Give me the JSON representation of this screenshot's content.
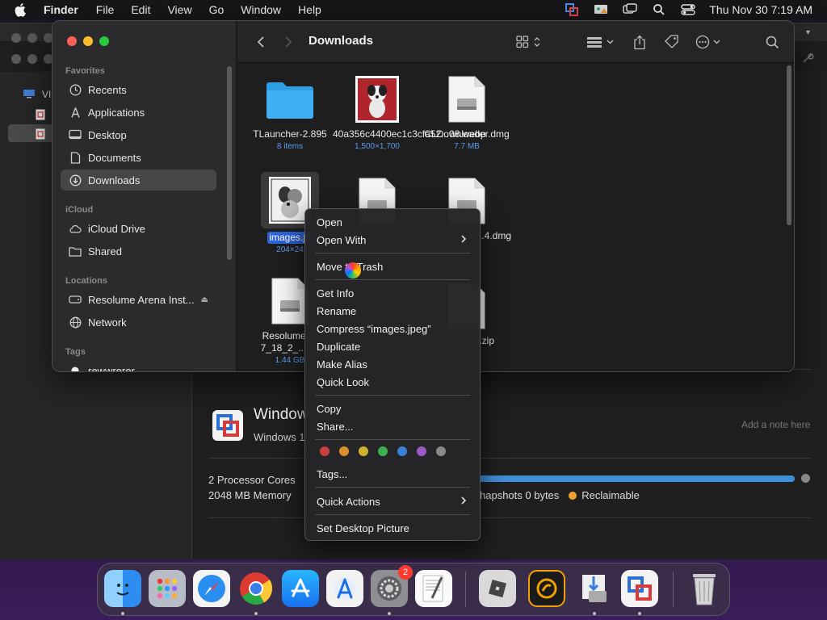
{
  "menubar": {
    "app_name": "Finder",
    "items": [
      "File",
      "Edit",
      "View",
      "Go",
      "Window",
      "Help"
    ],
    "clock": "Thu Nov 30  7:19 AM"
  },
  "vm_window": {
    "title": "Window",
    "subtitle": "Windows 1",
    "note_placeholder": "Add a note here",
    "cpu": "2 Processor Cores",
    "memory": "2048 MB Memory",
    "snapshots": "hapshots  0 bytes",
    "reclaimable": "Reclaimable",
    "sidebar_label": "VI"
  },
  "finder": {
    "title": "Downloads",
    "sidebar": {
      "favorites_header": "Favorites",
      "favorites": [
        "Recents",
        "Applications",
        "Desktop",
        "Documents",
        "Downloads"
      ],
      "icloud_header": "iCloud",
      "icloud": [
        "iCloud Drive",
        "Shared"
      ],
      "locations_header": "Locations",
      "locations": [
        "Resolume Arena Inst...",
        "Network"
      ],
      "tags_header": "Tags",
      "tags": [
        "rewwrerer"
      ]
    },
    "files": [
      {
        "name": "TLauncher-2.895",
        "meta": "8 items",
        "kind": "folder"
      },
      {
        "name": "40a356c4400ec1c3cfa52...08.webp",
        "meta": "1,500×1,700",
        "kind": "image"
      },
      {
        "name": "CLDownloader.dmg",
        "meta": "7.7 MB",
        "kind": "dmg"
      },
      {
        "name": "images.jp",
        "meta": "204×24",
        "kind": "image"
      },
      {
        "name": "",
        "meta": "",
        "kind": "dmg"
      },
      {
        "name": "v1-...4.dmg",
        "meta": "",
        "kind": "dmg"
      },
      {
        "name": "Resolume_A 7_18_2_...ller",
        "meta": "1.44 GB",
        "kind": "dmg"
      },
      {
        "name": "in.zip",
        "meta": "",
        "kind": "zip"
      }
    ]
  },
  "context_menu": {
    "items": {
      "open": "Open",
      "open_with": "Open With",
      "move_to_trash": "Move to Trash",
      "get_info": "Get Info",
      "rename": "Rename",
      "compress": "Compress “images.jpeg”",
      "duplicate": "Duplicate",
      "make_alias": "Make Alias",
      "quick_look": "Quick Look",
      "copy": "Copy",
      "share": "Share...",
      "tags": "Tags...",
      "quick_actions": "Quick Actions",
      "set_desktop": "Set Desktop Picture"
    },
    "tag_colors": [
      "#c94040",
      "#d8902e",
      "#d0b030",
      "#3fb04f",
      "#3b7fd8",
      "#9a5ac8",
      "#8a8a8a"
    ]
  },
  "dock": {
    "apps": [
      "finder",
      "launchpad",
      "safari",
      "chrome",
      "app-store",
      "xcode-instruments",
      "system-settings",
      "textedit",
      "roblox",
      "cinema",
      "installer",
      "vmware-fusion",
      "trash"
    ],
    "settings_badge": "2"
  },
  "colors": {
    "accent": "#2c63d8",
    "meta_blue": "#5b9cf0"
  }
}
